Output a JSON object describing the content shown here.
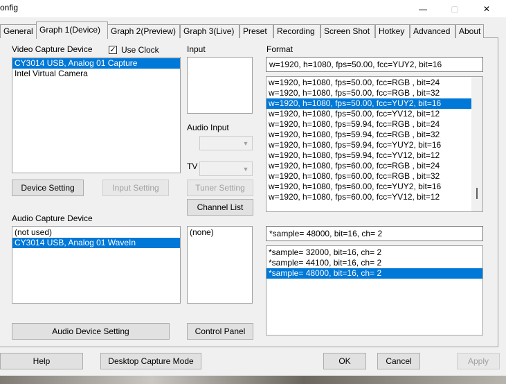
{
  "window": {
    "title": "onfig"
  },
  "caption": {
    "minimize": "—",
    "maximize": "▢",
    "close": "✕"
  },
  "tabs": [
    {
      "label": "General"
    },
    {
      "label": "Graph 1(Device)"
    },
    {
      "label": "Graph 2(Preview)"
    },
    {
      "label": "Graph 3(Live)"
    },
    {
      "label": "Preset"
    },
    {
      "label": "Recording"
    },
    {
      "label": "Screen Shot"
    },
    {
      "label": "Hotkey"
    },
    {
      "label": "Advanced"
    },
    {
      "label": "About"
    }
  ],
  "video": {
    "label": "Video Capture Device",
    "use_clock_label": "Use Clock",
    "use_clock_checked": true,
    "check_mark": "✓",
    "devices": [
      {
        "label": "CY3014 USB, Analog 01 Capture",
        "selected": true
      },
      {
        "label": "Intel Virtual Camera",
        "selected": false
      }
    ],
    "device_setting": "Device Setting",
    "input_setting": "Input Setting"
  },
  "input": {
    "label": "Input",
    "audio_input_label": "Audio Input",
    "tv_label": "TV",
    "tuner_setting": "Tuner Setting",
    "channel_list": "Channel List"
  },
  "format": {
    "label": "Format",
    "current": "w=1920, h=1080, fps=50.00,  fcc=YUY2, bit=16",
    "items": [
      {
        "label": "w=1920, h=1080, fps=50.00,  fcc=RGB , bit=24",
        "selected": false
      },
      {
        "label": "w=1920, h=1080, fps=50.00,  fcc=RGB , bit=32",
        "selected": false
      },
      {
        "label": "w=1920, h=1080, fps=50.00,  fcc=YUY2, bit=16",
        "selected": true
      },
      {
        "label": "w=1920, h=1080, fps=50.00,  fcc=YV12, bit=12",
        "selected": false
      },
      {
        "label": "w=1920, h=1080, fps=59.94,  fcc=RGB , bit=24",
        "selected": false
      },
      {
        "label": "w=1920, h=1080, fps=59.94,  fcc=RGB , bit=32",
        "selected": false
      },
      {
        "label": "w=1920, h=1080, fps=59.94,  fcc=YUY2, bit=16",
        "selected": false
      },
      {
        "label": "w=1920, h=1080, fps=59.94,  fcc=YV12, bit=12",
        "selected": false
      },
      {
        "label": "w=1920, h=1080, fps=60.00,  fcc=RGB , bit=24",
        "selected": false
      },
      {
        "label": "w=1920, h=1080, fps=60.00,  fcc=RGB , bit=32",
        "selected": false
      },
      {
        "label": "w=1920, h=1080, fps=60.00,  fcc=YUY2, bit=16",
        "selected": false
      },
      {
        "label": "w=1920, h=1080, fps=60.00,  fcc=YV12, bit=12",
        "selected": false
      }
    ]
  },
  "audio": {
    "label": "Audio Capture Device",
    "devices": [
      {
        "label": "(not used)",
        "selected": false
      },
      {
        "label": "CY3014 USB, Analog 01 WaveIn",
        "selected": true
      }
    ],
    "input_items": [
      {
        "label": "(none)"
      }
    ],
    "device_setting": "Audio Device Setting",
    "control_panel": "Control Panel",
    "current_format": "*sample= 48000, bit=16, ch= 2",
    "formats": [
      {
        "label": "*sample= 32000, bit=16, ch= 2",
        "selected": false
      },
      {
        "label": "*sample= 44100, bit=16, ch= 2",
        "selected": false
      },
      {
        "label": "*sample= 48000, bit=16, ch= 2",
        "selected": true
      }
    ]
  },
  "footer": {
    "help": "Help",
    "desktop_capture": "Desktop Capture Mode",
    "ok": "OK",
    "cancel": "Cancel",
    "apply": "Apply"
  }
}
